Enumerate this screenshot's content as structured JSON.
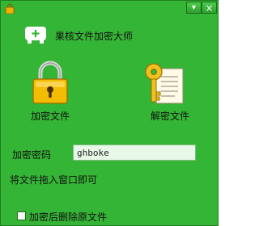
{
  "window": {
    "title_bar": {
      "menu_button_glyph": "▾",
      "close_button_glyph": "×"
    }
  },
  "app": {
    "name": "果核文件加密大师",
    "icon": "usb-plus-icon"
  },
  "actions": {
    "encrypt_label": "加密文件",
    "decrypt_label": "解密文件",
    "encrypt_icon": "padlock-icon",
    "decrypt_icon": "key-document-icon"
  },
  "password": {
    "label": "加密密码",
    "value": "ghboke"
  },
  "hint": "将文件拖入窗口即可",
  "delete_option": {
    "label": "加密后删除原文件",
    "checked": false
  },
  "colors": {
    "background": "#35b535",
    "lock": "#e8b400",
    "key": "#f0c020"
  }
}
